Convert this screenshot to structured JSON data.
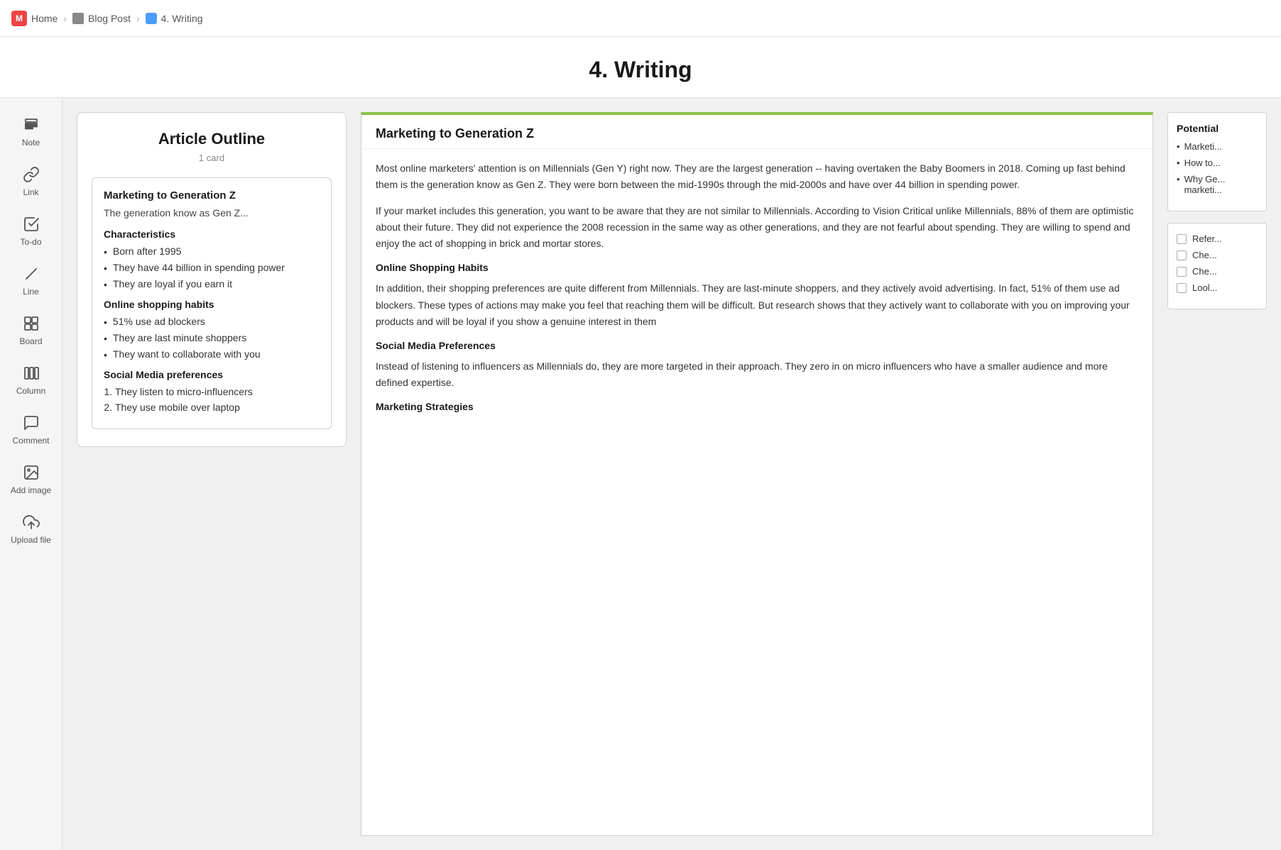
{
  "breadcrumb": {
    "home_label": "Home",
    "blog_post_label": "Blog Post",
    "writing_label": "4. Writing"
  },
  "page_title": "4. Writing",
  "sidebar": {
    "items": [
      {
        "id": "note",
        "label": "Note",
        "icon": "note-icon"
      },
      {
        "id": "link",
        "label": "Link",
        "icon": "link-icon"
      },
      {
        "id": "todo",
        "label": "To-do",
        "icon": "todo-icon"
      },
      {
        "id": "line",
        "label": "Line",
        "icon": "line-icon"
      },
      {
        "id": "board",
        "label": "Board",
        "icon": "board-icon"
      },
      {
        "id": "column",
        "label": "Column",
        "icon": "column-icon"
      },
      {
        "id": "comment",
        "label": "Comment",
        "icon": "comment-icon"
      },
      {
        "id": "add-image",
        "label": "Add image",
        "icon": "image-icon"
      },
      {
        "id": "upload-file",
        "label": "Upload file",
        "icon": "upload-icon"
      }
    ]
  },
  "outline": {
    "title": "Article Outline",
    "subtitle": "1 card",
    "card": {
      "heading": "Marketing to Generation Z",
      "description": "The generation know as Gen Z...",
      "sections": [
        {
          "heading": "Characteristics",
          "type": "bullet",
          "items": [
            "Born after 1995",
            "They have 44 billion in spending power",
            "They are loyal if you earn it"
          ]
        },
        {
          "heading": "Online shopping habits",
          "type": "bullet",
          "items": [
            "51% use ad blockers",
            "They are last minute shoppers",
            "They want to collaborate with you"
          ]
        },
        {
          "heading": "Social Media preferences",
          "type": "numbered",
          "items": [
            "They listen to micro-influencers",
            "They use mobile over laptop"
          ]
        }
      ]
    }
  },
  "article": {
    "title": "Marketing to Generation Z",
    "paragraphs": [
      "Most online marketers' attention is on Millennials (Gen Y) right now. They are the largest generation -- having overtaken the Baby Boomers in 2018. Coming up fast behind them is the generation know as Gen Z. They were born between the mid-1990s through the mid-2000s and have over 44 billion in spending power.",
      "If your market includes this generation, you want to be aware that they are not similar to Millennials. According to Vision Critical unlike Millennials, 88% of them are optimistic about their future. They did not experience the 2008 recession in the same way as other generations, and they are not fearful about spending. They are willing to spend and enjoy the act of shopping in brick and mortar stores."
    ],
    "sections": [
      {
        "heading": "Online Shopping Habits",
        "content": "In addition, their shopping preferences are quite different from Millennials. They are last-minute shoppers, and they actively avoid advertising. In fact, 51% of them use ad blockers. These types of actions may make you feel that reaching them will be difficult. But research shows that they actively want to collaborate with you on improving your products and will be loyal if you show a genuine interest in them"
      },
      {
        "heading": "Social Media Preferences",
        "content": "Instead of listening to influencers as Millennials do, they are more targeted in their approach. They zero in on micro influencers who have a smaller audience and more defined expertise."
      },
      {
        "heading": "Marketing Strategies",
        "content": ""
      }
    ]
  },
  "right_panel": {
    "potential_card": {
      "title": "Potential",
      "items": [
        "Marketi...",
        "How to...",
        "Why Ge... marketi..."
      ]
    },
    "checklist_card": {
      "items": [
        "Refer...",
        "Che...",
        "Che...",
        "Lool..."
      ]
    }
  }
}
